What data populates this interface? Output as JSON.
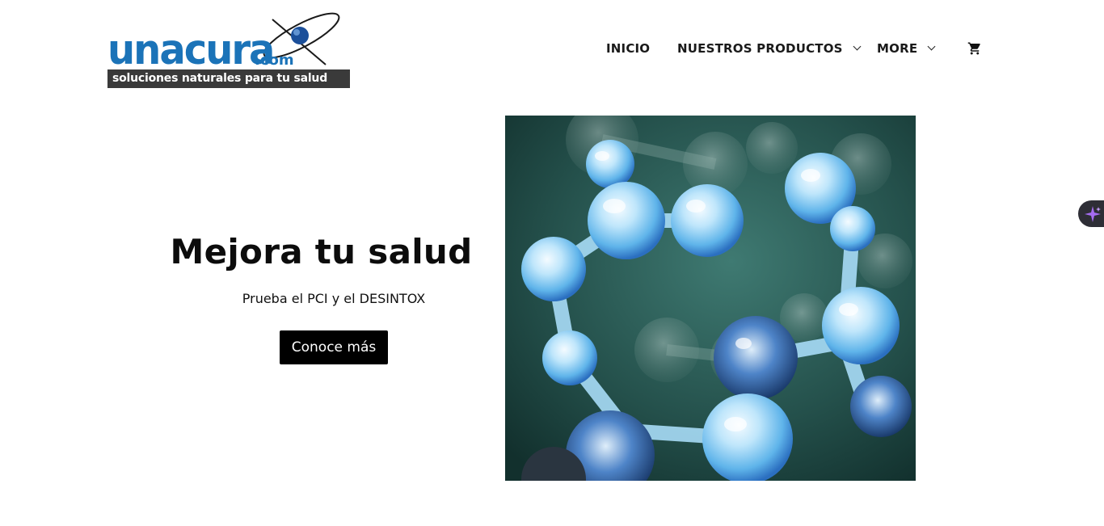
{
  "logo": {
    "word": "unacura",
    "dotcom": ".com",
    "tagline": "soluciones naturales para tu salud"
  },
  "nav": {
    "items": [
      {
        "label": "INICIO",
        "has_dropdown": false
      },
      {
        "label": "NUESTROS PRODUCTOS",
        "has_dropdown": true
      },
      {
        "label": "MORE",
        "has_dropdown": true
      }
    ],
    "cart_icon": "shopping-cart-icon"
  },
  "hero": {
    "title": "Mejora tu salud",
    "subtitle": "Prueba el PCI y el DESINTOX",
    "button_label": "Conoce más"
  },
  "colors": {
    "brand_blue": "#1b73b8",
    "tagline_bg": "#3a3a3a",
    "button_bg": "#000000",
    "widget_bg": "#2e2e36",
    "widget_accent": "#a56cf0"
  },
  "side_widget": {
    "icon": "sparkle-icon"
  }
}
